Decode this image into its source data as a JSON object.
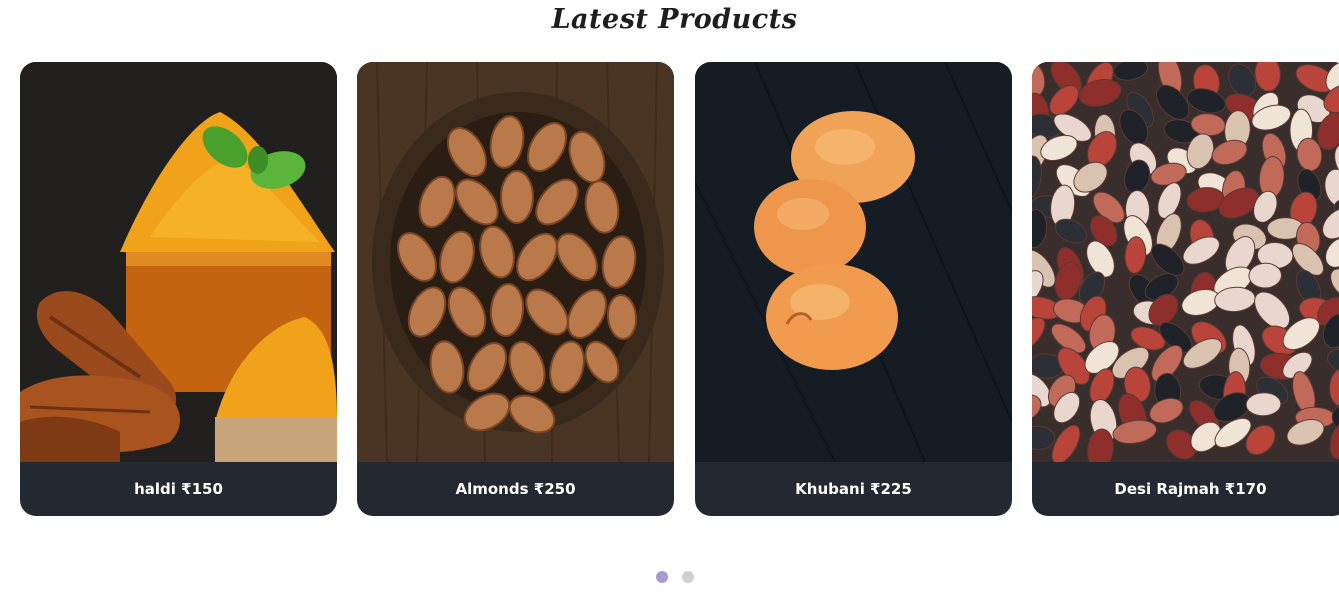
{
  "section": {
    "title": "Latest Products"
  },
  "products": [
    {
      "name": "haldi",
      "price": "₹150",
      "label": "haldi ₹150"
    },
    {
      "name": "Almonds",
      "price": "₹250",
      "label": "Almonds ₹250"
    },
    {
      "name": "Khubani",
      "price": "₹225",
      "label": "Khubani ₹225"
    },
    {
      "name": "Desi Rajmah",
      "price": "₹170",
      "label": "Desi Rajmah ₹170"
    }
  ],
  "carousel": {
    "page_count": 2,
    "active_page": 1
  },
  "colors": {
    "caption_bg": "#242831",
    "dot_active": "#a99ad0",
    "dot_inactive": "#cfcfcf"
  }
}
